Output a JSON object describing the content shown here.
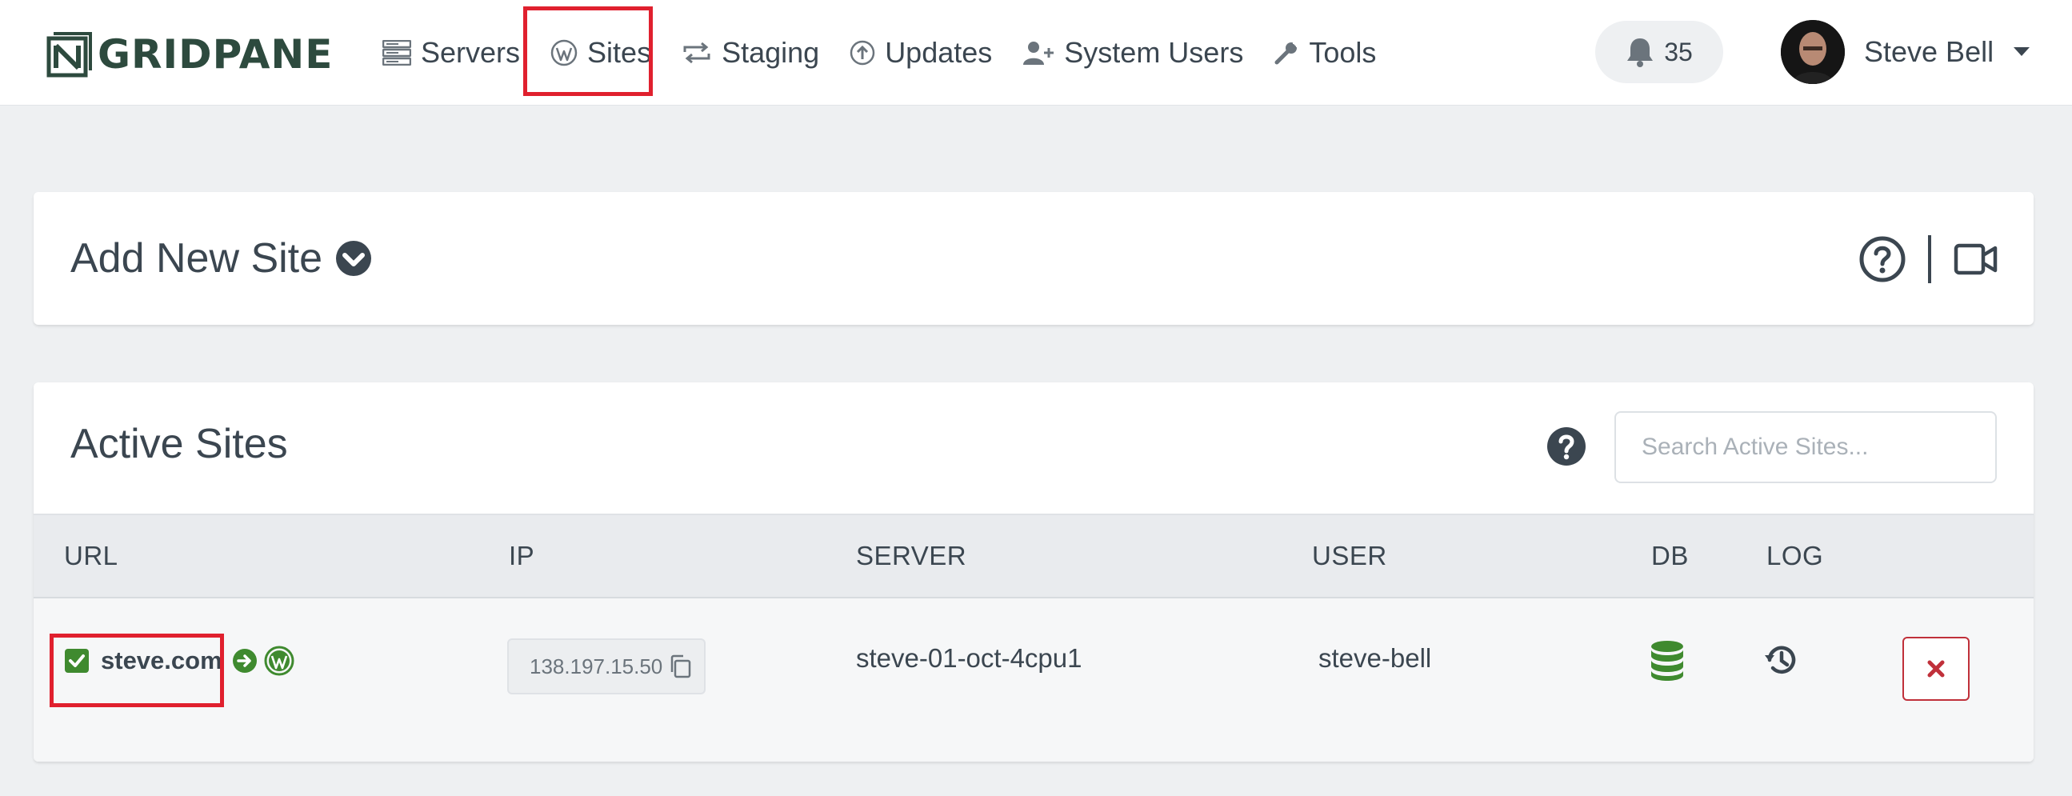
{
  "brand": {
    "name": "GRIDPANE"
  },
  "nav": {
    "items": [
      {
        "label": "Servers",
        "icon": "servers-icon"
      },
      {
        "label": "Sites",
        "icon": "wordpress-icon"
      },
      {
        "label": "Staging",
        "icon": "staging-icon"
      },
      {
        "label": "Updates",
        "icon": "updates-icon"
      },
      {
        "label": "System Users",
        "icon": "user-plus-icon"
      },
      {
        "label": "Tools",
        "icon": "wrench-icon"
      }
    ],
    "notifications": {
      "count": "35",
      "icon": "bell-icon"
    },
    "user": {
      "name": "Steve Bell"
    }
  },
  "add_site": {
    "title": "Add New Site"
  },
  "active_sites": {
    "title": "Active Sites",
    "search_placeholder": "Search Active Sites...",
    "columns": [
      "URL",
      "IP",
      "SERVER",
      "USER",
      "DB",
      "LOG"
    ],
    "rows": [
      {
        "url": "steve.com",
        "ip": "138.197.15.50",
        "server": "steve-01-oct-4cpu1",
        "user": "steve-bell"
      }
    ]
  },
  "colors": {
    "accent_green": "#3f8a2f",
    "text_dark": "#3b4650",
    "highlight_red": "#e0202e",
    "danger_red": "#c0303a",
    "logo_green": "#2d4a3e"
  }
}
